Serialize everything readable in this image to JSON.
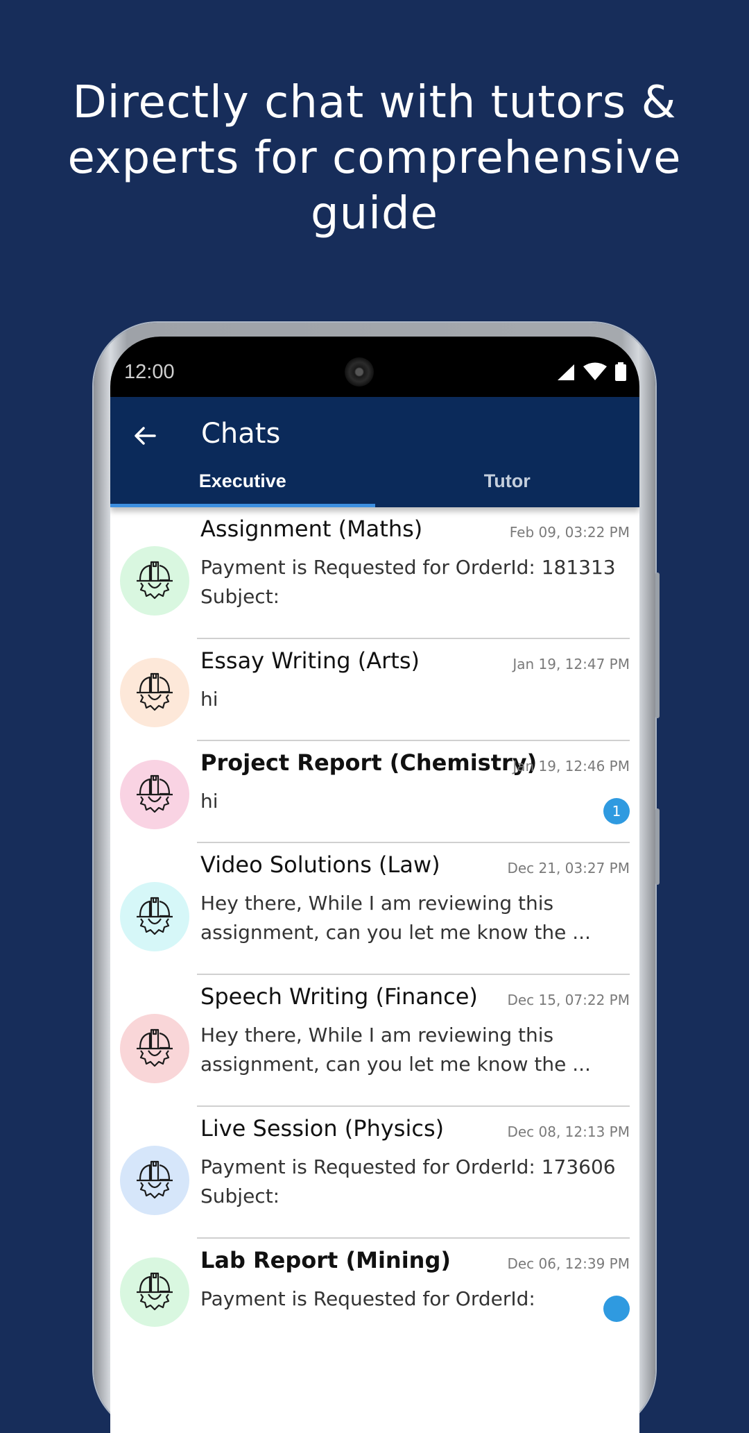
{
  "headline": "Directly chat with tutors & experts for comprehensive guide",
  "status_bar": {
    "time": "12:00",
    "icons": [
      "signal-icon",
      "wifi-icon",
      "battery-icon"
    ]
  },
  "app_bar": {
    "back_icon": "arrow-left-icon",
    "title": "Chats"
  },
  "tabs": [
    {
      "label": "Executive",
      "active": true
    },
    {
      "label": "Tutor",
      "active": false
    }
  ],
  "colors": {
    "background": "#172d5a",
    "app_bar": "#0b2a5a",
    "tab_indicator": "#3d8fe0",
    "badge": "#2f9ae0"
  },
  "chats": [
    {
      "title": "Assignment (Maths)",
      "time": "Feb 09, 03:22 PM",
      "message_lines": [
        "Payment is Requested for OrderId: 181313",
        "Subject:"
      ],
      "avatar_color": "#d9f7e0",
      "unread": null,
      "bold": false
    },
    {
      "title": "Essay Writing (Arts)",
      "time": "Jan 19, 12:47 PM",
      "message_lines": [
        "hi"
      ],
      "avatar_color": "#fde8d9",
      "unread": null,
      "bold": false
    },
    {
      "title": "Project Report (Chemistry)",
      "time": "Jan 19, 12:46 PM",
      "message_lines": [
        "hi"
      ],
      "avatar_color": "#f9d3e3",
      "unread": "1",
      "bold": true
    },
    {
      "title": "Video Solutions (Law)",
      "time": "Dec 21, 03:27 PM",
      "message_lines": [
        "Hey there, While I am reviewing this",
        "assignment, can you let me know the ..."
      ],
      "avatar_color": "#d6f7f8",
      "unread": null,
      "bold": false
    },
    {
      "title": "Speech Writing (Finance)",
      "time": "Dec 15, 07:22 PM",
      "message_lines": [
        "Hey there, While I am reviewing this",
        "assignment, can you let me know the ..."
      ],
      "avatar_color": "#f9d6d8",
      "unread": null,
      "bold": false
    },
    {
      "title": "Live Session (Physics)",
      "time": "Dec 08, 12:13 PM",
      "message_lines": [
        "Payment is Requested for OrderId: 173606",
        "Subject:"
      ],
      "avatar_color": "#d6e6fa",
      "unread": null,
      "bold": false
    },
    {
      "title": "Lab Report (Mining)",
      "time": "Dec 06, 12:39 PM",
      "message_lines": [
        "Payment is Requested for OrderId:"
      ],
      "avatar_color": "#d9f7e0",
      "unread": "",
      "bold": true
    }
  ]
}
